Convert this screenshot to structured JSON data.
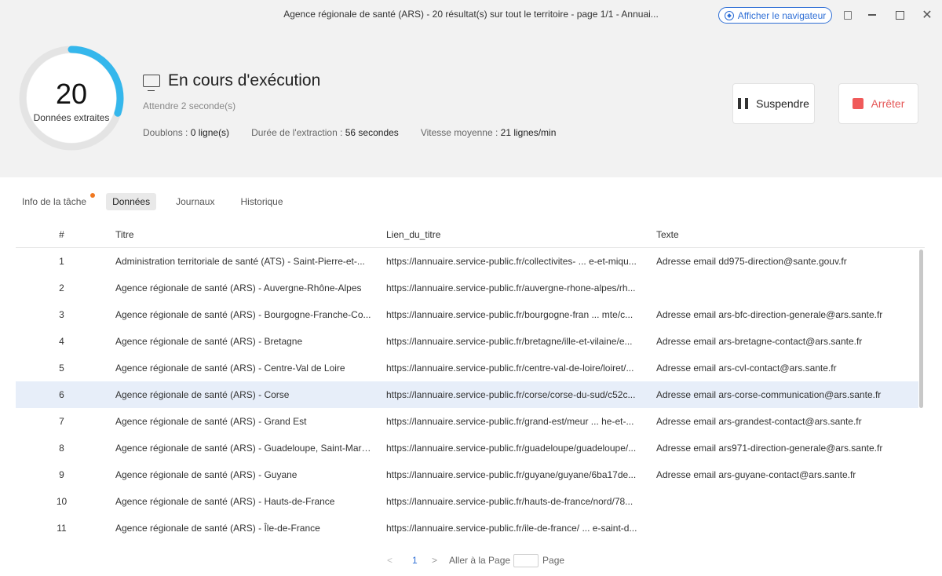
{
  "window": {
    "title": "Agence régionale de santé (ARS) - 20 résultat(s) sur tout le territoire - page 1/1 - Annuai...",
    "browser_button": "Afficher le navigateur",
    "controls": {
      "min": "",
      "max": "",
      "close": "✕"
    }
  },
  "progress": {
    "count": "20",
    "label": "Données extraites",
    "ring_fraction": 0.3
  },
  "status": {
    "title": "En cours d'exécution",
    "subtitle": "Attendre 2 seconde(s)",
    "duplicates_label": "Doublons : ",
    "duplicates_value": "0 ligne(s)",
    "duration_label": "Durée de l'extraction : ",
    "duration_value": "56 secondes",
    "speed_label": "Vitesse moyenne : ",
    "speed_value": "21 lignes/min"
  },
  "actions": {
    "suspend": "Suspendre",
    "stop": "Arrêter"
  },
  "colors": {
    "accent": "#2f6fd6",
    "ring": "#35b7ec",
    "stop": "#f05a5a",
    "notify": "#f07820",
    "selected_row": "#e7eef9"
  },
  "tabs": [
    {
      "label": "Info de la tâche",
      "active": false,
      "notify": true
    },
    {
      "label": "Données",
      "active": true,
      "notify": false
    },
    {
      "label": "Journaux",
      "active": false,
      "notify": false
    },
    {
      "label": "Historique",
      "active": false,
      "notify": false
    }
  ],
  "table": {
    "columns": [
      "#",
      "Titre",
      "Lien_du_titre",
      "Texte"
    ],
    "selected_row": 5,
    "rows": [
      [
        "1",
        "Administration territoriale de santé (ATS) - Saint-Pierre-et-...",
        "https://lannuaire.service-public.fr/collectivites- ... e-et-miqu...",
        "Adresse email dd975-direction@sante.gouv.fr"
      ],
      [
        "2",
        "Agence régionale de santé (ARS) - Auvergne-Rhône-Alpes",
        "https://lannuaire.service-public.fr/auvergne-rhone-alpes/rh...",
        ""
      ],
      [
        "3",
        "Agence régionale de santé (ARS) - Bourgogne-Franche-Co...",
        "https://lannuaire.service-public.fr/bourgogne-fran ... mte/c...",
        "Adresse email ars-bfc-direction-generale@ars.sante.fr"
      ],
      [
        "4",
        "Agence régionale de santé (ARS) - Bretagne",
        "https://lannuaire.service-public.fr/bretagne/ille-et-vilaine/e...",
        "Adresse email ars-bretagne-contact@ars.sante.fr"
      ],
      [
        "5",
        "Agence régionale de santé (ARS) - Centre-Val de Loire",
        "https://lannuaire.service-public.fr/centre-val-de-loire/loiret/...",
        "Adresse email ars-cvl-contact@ars.sante.fr"
      ],
      [
        "6",
        "Agence régionale de santé (ARS) - Corse",
        "https://lannuaire.service-public.fr/corse/corse-du-sud/c52c...",
        "Adresse email ars-corse-communication@ars.sante.fr"
      ],
      [
        "7",
        "Agence régionale de santé (ARS) - Grand Est",
        "https://lannuaire.service-public.fr/grand-est/meur ... he-et-...",
        "Adresse email ars-grandest-contact@ars.sante.fr"
      ],
      [
        "8",
        "Agence régionale de santé (ARS) - Guadeloupe, Saint-Marti...",
        "https://lannuaire.service-public.fr/guadeloupe/guadeloupe/...",
        "Adresse email ars971-direction-generale@ars.sante.fr"
      ],
      [
        "9",
        "Agence régionale de santé (ARS) - Guyane",
        "https://lannuaire.service-public.fr/guyane/guyane/6ba17de...",
        "Adresse email ars-guyane-contact@ars.sante.fr"
      ],
      [
        "10",
        "Agence régionale de santé (ARS) - Hauts-de-France",
        "https://lannuaire.service-public.fr/hauts-de-france/nord/78...",
        ""
      ],
      [
        "11",
        "Agence régionale de santé (ARS) - Île-de-France",
        "https://lannuaire.service-public.fr/ile-de-france/ ... e-saint-d...",
        ""
      ]
    ]
  },
  "pagination": {
    "prev": "<",
    "current": "1",
    "next": ">",
    "goto_label": "Aller à la Page",
    "goto_value": "",
    "page_label": "Page"
  }
}
